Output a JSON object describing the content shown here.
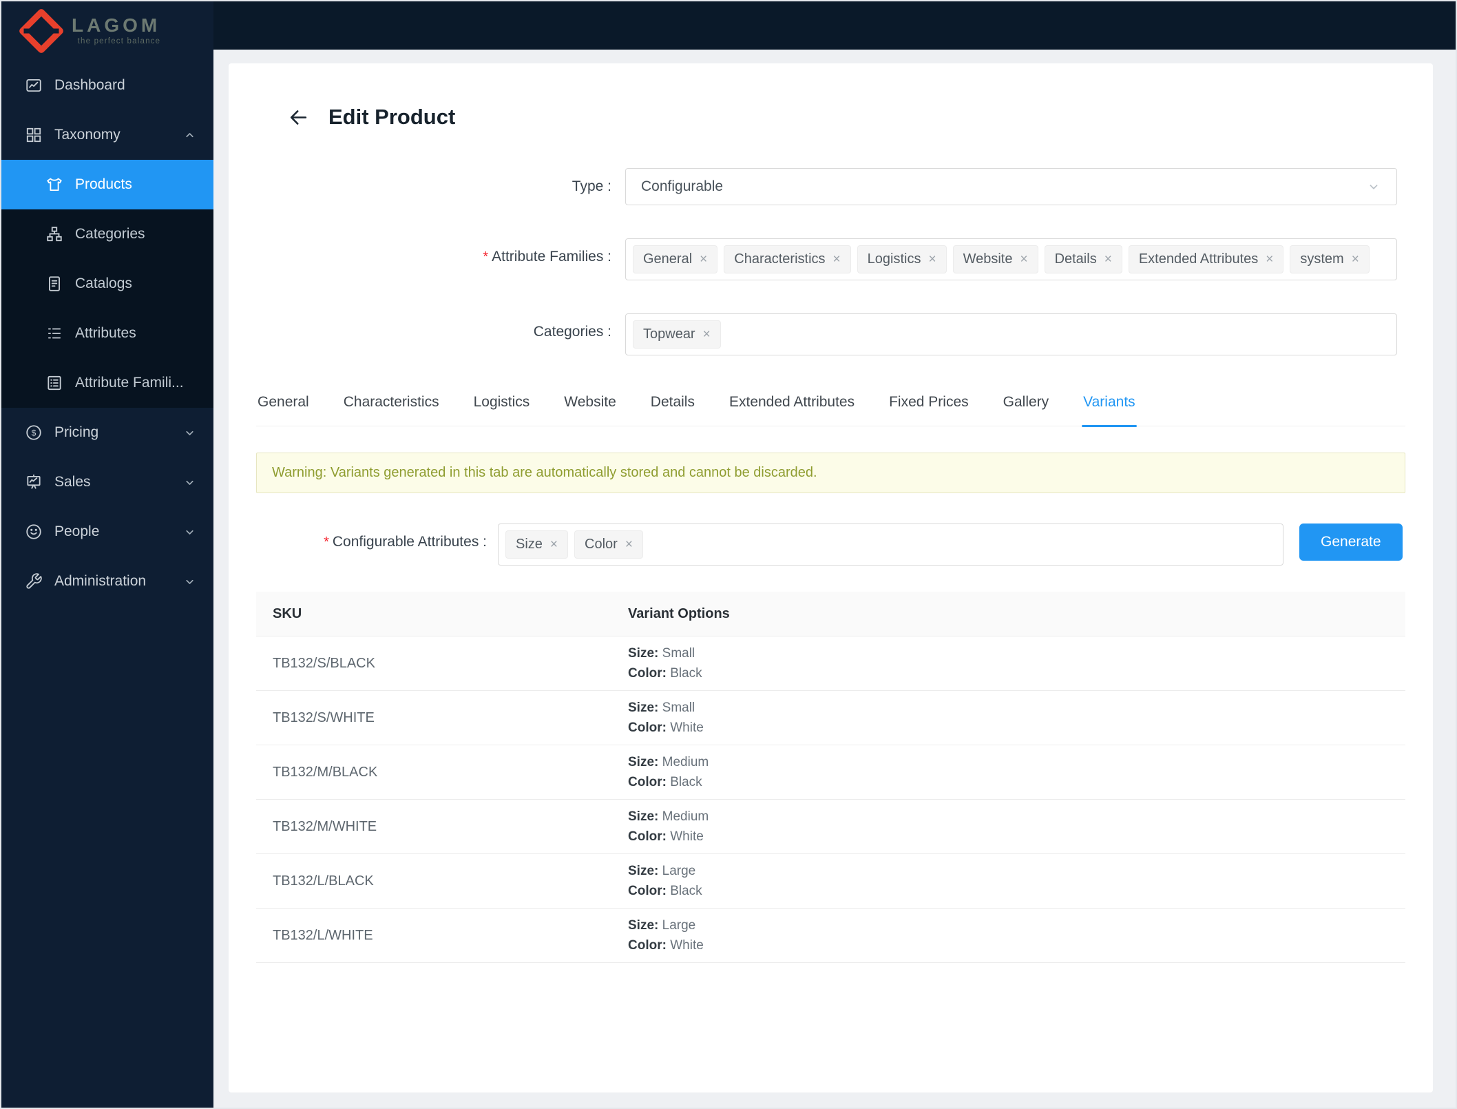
{
  "colors": {
    "accent": "#2196f3",
    "sidebar_bg": "#0e1e33",
    "submenu_bg": "#071320",
    "brand_red": "#e8402c",
    "warning_text": "#8f9d30",
    "warning_bg": "#fcfce8",
    "required": "#f5222d"
  },
  "icons": {
    "back": "arrow-left",
    "select_caret": "chevron-down",
    "taxonomy_state": "chevron-up",
    "collapsed_state": "chevron-down",
    "remove_tag": "x",
    "sidebar": [
      "chart",
      "grid",
      "tshirt",
      "tree",
      "document",
      "list",
      "boxed-list",
      "dollar",
      "presentation",
      "smiley",
      "wrench"
    ]
  },
  "sidebar": {
    "brand": "LAGOM",
    "tagline": "the perfect balance",
    "menu": {
      "dashboard": "Dashboard",
      "taxonomy": "Taxonomy",
      "products": "Products",
      "categories": "Categories",
      "catalogs": "Catalogs",
      "attributes": "Attributes",
      "attribute_families": "Attribute Famili...",
      "pricing": "Pricing",
      "sales": "Sales",
      "people": "People",
      "administration": "Administration"
    }
  },
  "header": {
    "title": "Edit Product"
  },
  "form": {
    "required_marker": "*",
    "remove_icon": "×",
    "type": {
      "label": "Type :",
      "value": "Configurable"
    },
    "attribute_families": {
      "label": "Attribute Families :",
      "tags": [
        "General",
        "Characteristics",
        "Logistics",
        "Website",
        "Details",
        "Extended Attributes",
        "system"
      ]
    },
    "categories": {
      "label": "Categories :",
      "tags": [
        "Topwear"
      ]
    }
  },
  "tabs": [
    "General",
    "Characteristics",
    "Logistics",
    "Website",
    "Details",
    "Extended Attributes",
    "Fixed Prices",
    "Gallery",
    "Variants"
  ],
  "active_tab": "Variants",
  "warning": "Warning: Variants generated in this tab are automatically stored and cannot be discarded.",
  "variants": {
    "label": "Configurable Attributes :",
    "tags": [
      "Size",
      "Color"
    ],
    "generate": "Generate",
    "table": {
      "col_sku": "SKU",
      "col_options": "Variant Options",
      "size_label": "Size:",
      "color_label": "Color:",
      "rows": [
        {
          "sku": "TB132/S/BLACK",
          "size": "Small",
          "color": "Black"
        },
        {
          "sku": "TB132/S/WHITE",
          "size": "Small",
          "color": "White"
        },
        {
          "sku": "TB132/M/BLACK",
          "size": "Medium",
          "color": "Black"
        },
        {
          "sku": "TB132/M/WHITE",
          "size": "Medium",
          "color": "White"
        },
        {
          "sku": "TB132/L/BLACK",
          "size": "Large",
          "color": "Black"
        },
        {
          "sku": "TB132/L/WHITE",
          "size": "Large",
          "color": "White"
        }
      ]
    }
  }
}
